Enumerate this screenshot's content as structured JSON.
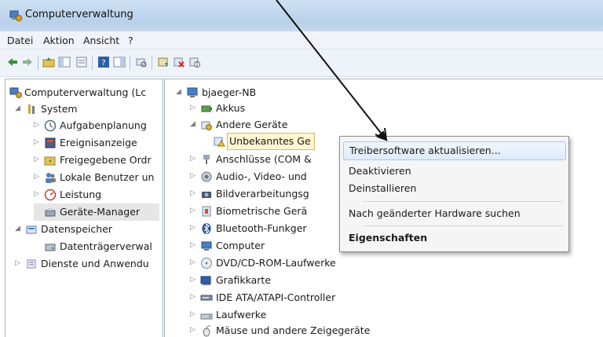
{
  "window": {
    "title": "Computerverwaltung"
  },
  "menubar": {
    "items": [
      "Datei",
      "Aktion",
      "Ansicht",
      "?"
    ]
  },
  "toolbar": {
    "icons": [
      "back-arrow-icon",
      "forward-arrow-icon",
      "up-folder-icon",
      "console-tree-icon",
      "properties-icon",
      "help-icon",
      "show-hide-icon",
      "scan-hardware-icon",
      "update-driver-icon",
      "uninstall-icon",
      "disable-icon"
    ]
  },
  "left_tree": {
    "root": "Computerverwaltung (Lc",
    "system": "System",
    "aufgabenplanung": "Aufgabenplanung",
    "ereignisanzeige": "Ereignisanzeige",
    "freigegebene": "Freigegebene Ordr",
    "lokale": "Lokale Benutzer un",
    "leistung": "Leistung",
    "geraete_manager": "Geräte-Manager",
    "datenspeicher": "Datenspeicher",
    "datentraeger": "Datenträgerverwal",
    "dienste": "Dienste und Anwendu"
  },
  "device_tree": {
    "computer_name": "bjaeger-NB",
    "items": {
      "akkus": "Akkus",
      "andere": "Andere Geräte",
      "unbekannt": "Unbekanntes Ge",
      "anschluesse": "Anschlüsse (COM &",
      "audio": "Audio-, Video- und",
      "bild": "Bildverarbeitungsg",
      "biometrisch": "Biometrische Gerä",
      "bluetooth": "Bluetooth-Funkger",
      "computer": "Computer",
      "dvd": "DVD/CD-ROM-Laufwerke",
      "grafik": "Grafikkarte",
      "ide": "IDE ATA/ATAPI-Controller",
      "laufwerke": "Laufwerke",
      "maeuse": "Mäuse und andere Zeigegeräte"
    }
  },
  "context_menu": {
    "update_driver": "Treibersoftware aktualisieren...",
    "deactivate": "Deaktivieren",
    "uninstall": "Deinstallieren",
    "scan": "Nach geänderter Hardware suchen",
    "properties": "Eigenschaften"
  },
  "colors": {
    "highlight": "#dcebfc",
    "titlebar": "#c7d9ee",
    "selection": "#fff5d0"
  }
}
